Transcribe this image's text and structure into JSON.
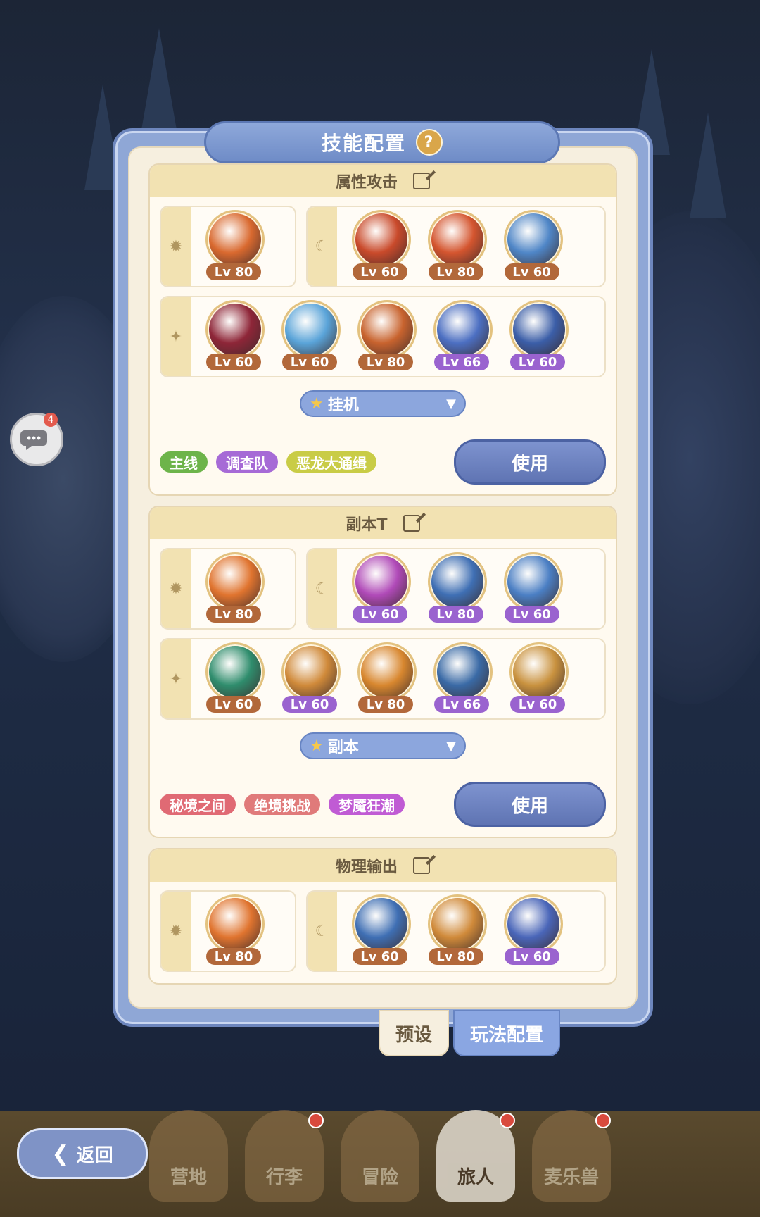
{
  "header": {
    "title": "技能配置",
    "help_icon": "?"
  },
  "chat": {
    "badge": "4"
  },
  "presets": [
    {
      "name": "属性攻击",
      "row1_left": {
        "icon": "sun-icon",
        "skills": [
          {
            "lv": "Lv 80",
            "color": "bronze",
            "orb": "#d9692f"
          }
        ]
      },
      "row1_right": {
        "icon": "moon-icon",
        "skills": [
          {
            "lv": "Lv 60",
            "color": "bronze",
            "orb": "#c94a2b"
          },
          {
            "lv": "Lv 80",
            "color": "bronze",
            "orb": "#d4552f"
          },
          {
            "lv": "Lv 60",
            "color": "bronze",
            "orb": "#4f86c7"
          }
        ]
      },
      "row2": {
        "icon": "sparkle-icon",
        "skills": [
          {
            "lv": "Lv 60",
            "color": "bronze",
            "orb": "#8e2638"
          },
          {
            "lv": "Lv 60",
            "color": "bronze",
            "orb": "#5aa4d9"
          },
          {
            "lv": "Lv 80",
            "color": "bronze",
            "orb": "#c8632e"
          },
          {
            "lv": "Lv 66",
            "color": "purple",
            "orb": "#4c6fc2"
          },
          {
            "lv": "Lv 60",
            "color": "purple",
            "orb": "#3b5ea8"
          }
        ]
      },
      "mode": "挂机",
      "tags": [
        {
          "label": "主线",
          "color": "#6db44a"
        },
        {
          "label": "调查队",
          "color": "#a66ad6"
        },
        {
          "label": "恶龙大通缉",
          "color": "#c9cc46"
        }
      ],
      "use_label": "使用"
    },
    {
      "name": "副本T",
      "row1_left": {
        "icon": "sun-icon",
        "skills": [
          {
            "lv": "Lv 80",
            "color": "bronze",
            "orb": "#e0742f"
          }
        ]
      },
      "row1_right": {
        "icon": "moon-icon",
        "skills": [
          {
            "lv": "Lv 60",
            "color": "purple",
            "orb": "#b04ab8"
          },
          {
            "lv": "Lv 80",
            "color": "purple",
            "orb": "#3f6fb4"
          },
          {
            "lv": "Lv 60",
            "color": "purple",
            "orb": "#4b7fc4"
          }
        ]
      },
      "row2": {
        "icon": "sparkle-icon",
        "skills": [
          {
            "lv": "Lv 60",
            "color": "bronze",
            "orb": "#2f8d6d"
          },
          {
            "lv": "Lv 60",
            "color": "purple",
            "orb": "#d08a3a"
          },
          {
            "lv": "Lv 80",
            "color": "bronze",
            "orb": "#d8872f"
          },
          {
            "lv": "Lv 66",
            "color": "purple",
            "orb": "#3a6aa6"
          },
          {
            "lv": "Lv 60",
            "color": "purple",
            "orb": "#c9923f"
          }
        ]
      },
      "mode": "副本",
      "tags": [
        {
          "label": "秘境之间",
          "color": "#e06a74"
        },
        {
          "label": "绝境挑战",
          "color": "#e07a7a"
        },
        {
          "label": "梦魇狂潮",
          "color": "#c05bd4"
        }
      ],
      "use_label": "使用"
    },
    {
      "name": "物理输出",
      "row1_left": {
        "icon": "sun-icon",
        "skills": [
          {
            "lv": "Lv 80",
            "color": "bronze",
            "orb": "#e0742f"
          }
        ]
      },
      "row1_right": {
        "icon": "moon-icon",
        "skills": [
          {
            "lv": "Lv 60",
            "color": "bronze",
            "orb": "#3f6fb4"
          },
          {
            "lv": "Lv 80",
            "color": "bronze",
            "orb": "#d08a3a"
          },
          {
            "lv": "Lv 60",
            "color": "purple",
            "orb": "#4a66b9"
          }
        ]
      }
    }
  ],
  "tabs": {
    "preset": "预设",
    "play": "玩法配置"
  },
  "nav": {
    "back": "返回",
    "items": [
      {
        "label": "营地",
        "dot": false,
        "active": false
      },
      {
        "label": "行李",
        "dot": true,
        "active": false
      },
      {
        "label": "冒险",
        "dot": false,
        "active": false
      },
      {
        "label": "旅人",
        "dot": true,
        "active": true
      },
      {
        "label": "麦乐兽",
        "dot": true,
        "active": false
      }
    ]
  }
}
